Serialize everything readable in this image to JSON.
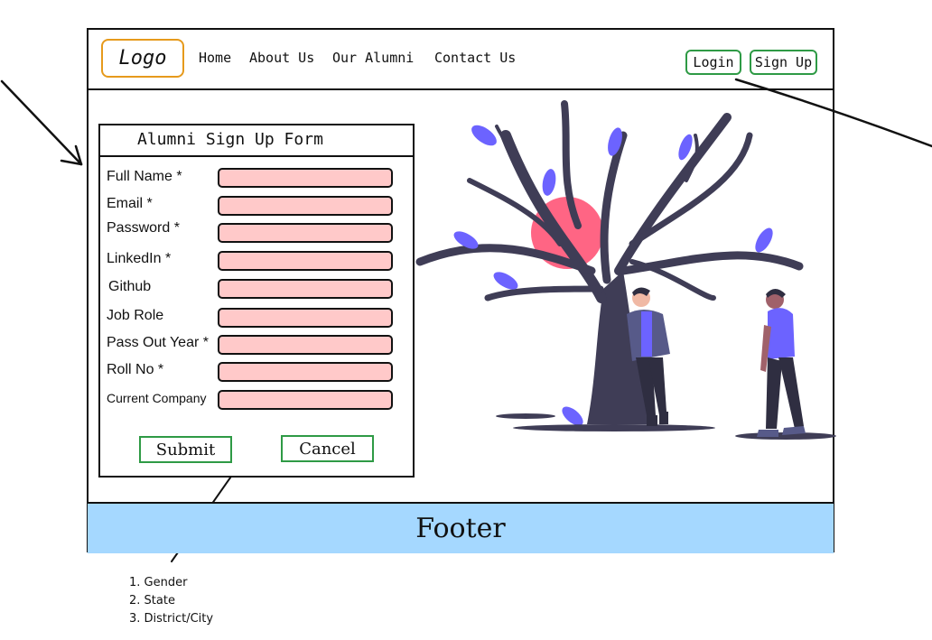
{
  "header": {
    "logo": "Logo",
    "nav": [
      "Home",
      "About Us",
      "Our Alumni",
      "Contact Us"
    ],
    "login": "Login",
    "signup": "Sign Up"
  },
  "form": {
    "title": "Alumni Sign Up Form",
    "fields": [
      {
        "label": "Full Name *"
      },
      {
        "label": "Email *"
      },
      {
        "label": "Password *"
      },
      {
        "label": "LinkedIn *"
      },
      {
        "label": "Github"
      },
      {
        "label": "Job Role"
      },
      {
        "label": "Pass Out Year *"
      },
      {
        "label": "Roll No *"
      },
      {
        "label": "Current Company"
      }
    ],
    "submit": "Submit",
    "cancel": "Cancel"
  },
  "footer": {
    "label": "Footer"
  },
  "notes": [
    "1. Gender",
    "2. State",
    "3. District/City"
  ],
  "colors": {
    "logo_border": "#e69a1c",
    "button_border": "#2e9a45",
    "field_fill": "#ffc9c9",
    "footer_fill": "#a5d8ff",
    "tree": "#3f3d56",
    "leaf": "#6c63ff",
    "sun": "#ff6584"
  }
}
